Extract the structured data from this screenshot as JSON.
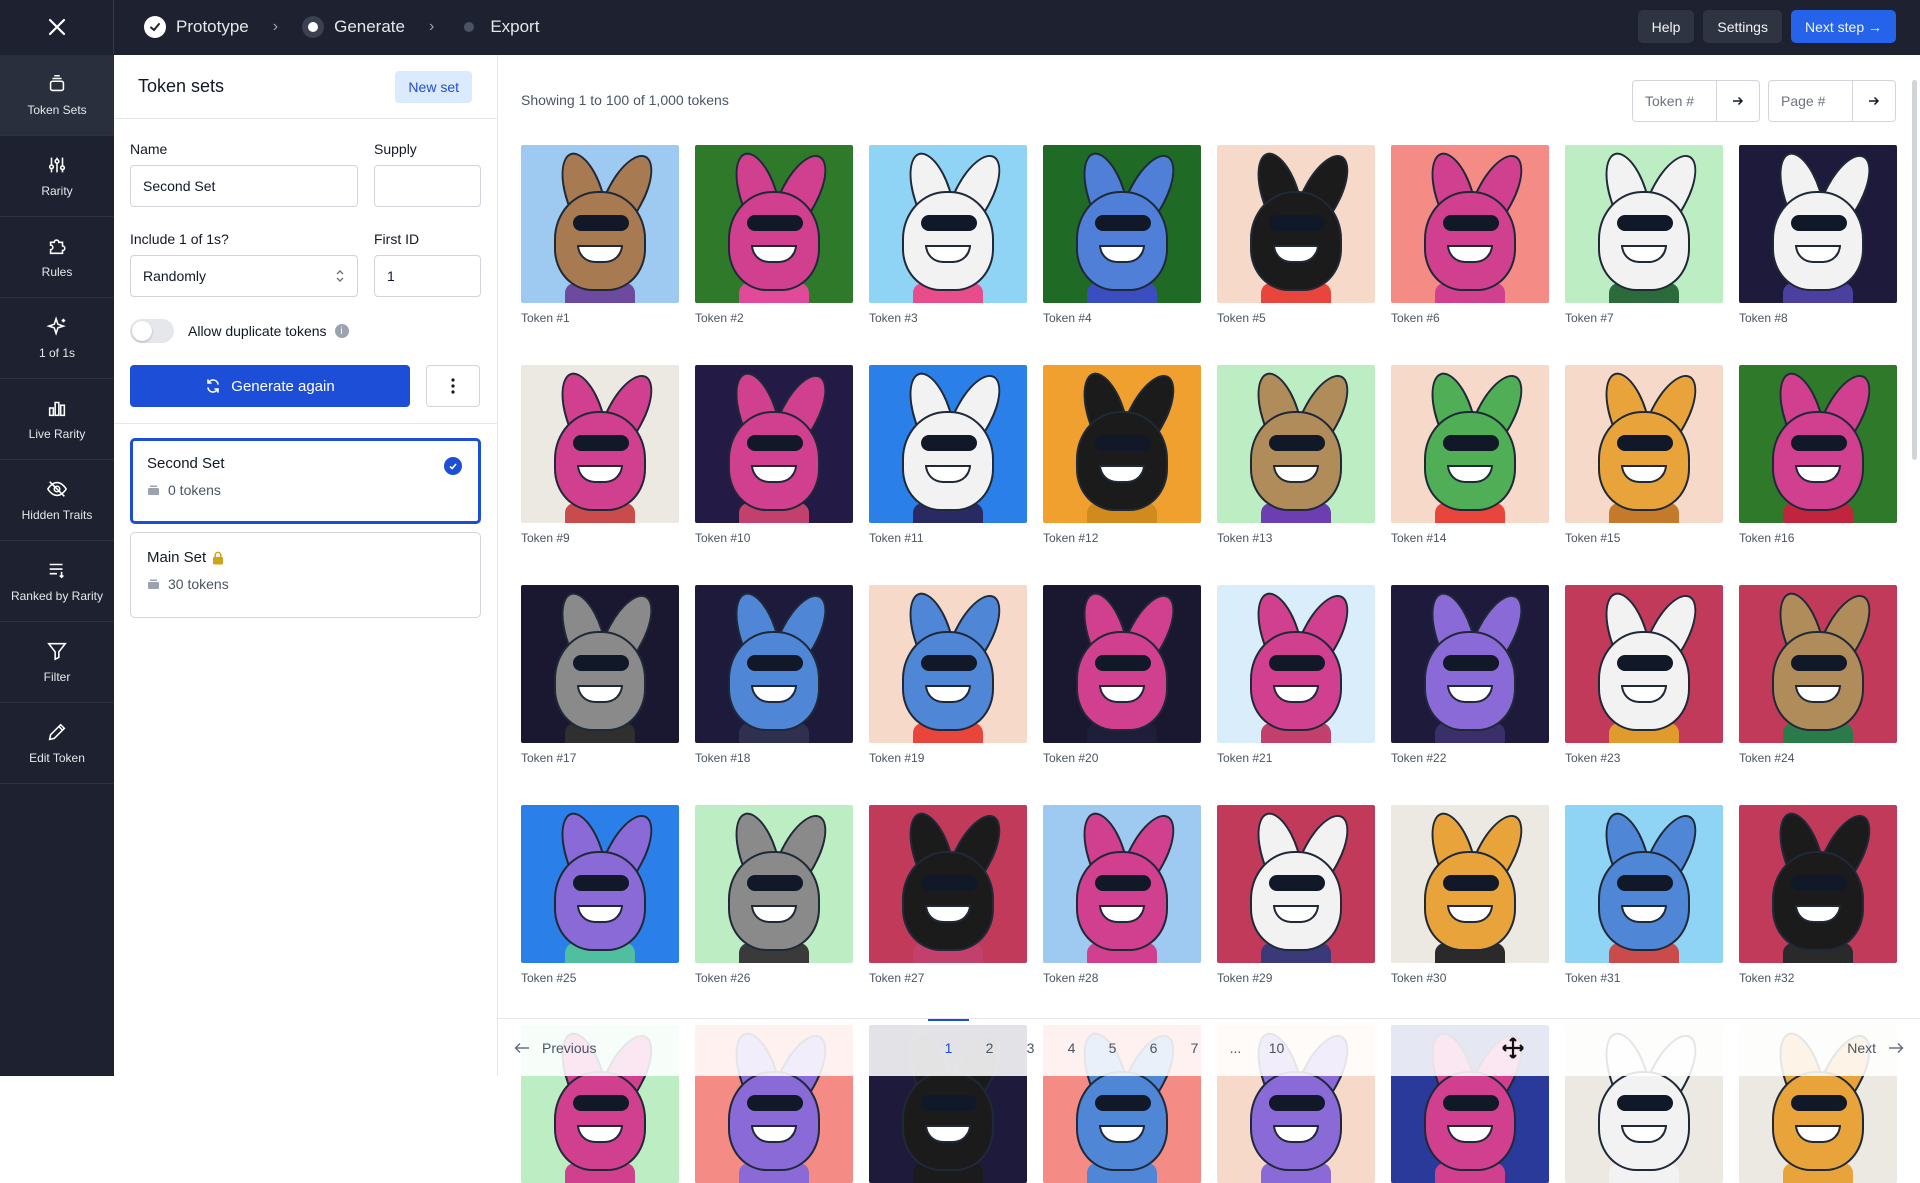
{
  "topbar": {
    "steps": [
      {
        "label": "Prototype",
        "state": "done"
      },
      {
        "label": "Generate",
        "state": "current"
      },
      {
        "label": "Export",
        "state": "upcoming"
      }
    ],
    "help_label": "Help",
    "settings_label": "Settings",
    "next_label": "Next step →",
    "accent": "#2563eb"
  },
  "rail": {
    "items": [
      {
        "label": "Token Sets",
        "icon": "stack-icon",
        "active": true
      },
      {
        "label": "Rarity",
        "icon": "sliders-icon"
      },
      {
        "label": "Rules",
        "icon": "puzzle-icon"
      },
      {
        "label": "1 of 1s",
        "icon": "sparkle-icon"
      },
      {
        "label": "Live Rarity",
        "icon": "bar-chart-icon"
      },
      {
        "label": "Hidden Traits",
        "icon": "eye-off-icon"
      },
      {
        "label": "Ranked by Rarity",
        "icon": "sort-list-icon"
      },
      {
        "label": "Filter",
        "icon": "filter-icon"
      },
      {
        "label": "Edit Token",
        "icon": "pencil-icon"
      }
    ]
  },
  "panel": {
    "title": "Token sets",
    "new_set_label": "New set",
    "name_label": "Name",
    "name_value": "Second Set",
    "supply_label": "Supply",
    "supply_value": "",
    "include_label": "Include 1 of 1s?",
    "include_value": "Randomly",
    "first_id_label": "First ID",
    "first_id_value": "1",
    "duplicate_label": "Allow duplicate tokens",
    "generate_label": "Generate again",
    "sets": [
      {
        "name": "Second Set",
        "count": "0 tokens",
        "selected": true,
        "locked": false
      },
      {
        "name": "Main Set",
        "count": "30 tokens",
        "selected": false,
        "locked": true
      }
    ]
  },
  "main": {
    "showing": "Showing 1 to 100 of 1,000 tokens",
    "token_jump_placeholder": "Token #",
    "page_jump_placeholder": "Page #",
    "tokens": [
      {
        "label": "Token #1",
        "bg": "#9ec9f0",
        "fur": "#a87a52",
        "body": "#6b4aa0"
      },
      {
        "label": "Token #2",
        "bg": "#2f7a2a",
        "fur": "#d13f8f",
        "body": "#e14a9b"
      },
      {
        "label": "Token #3",
        "bg": "#8fd3f5",
        "fur": "#f2f2f2",
        "body": "#e84c8b"
      },
      {
        "label": "Token #4",
        "bg": "#1f6a24",
        "fur": "#4f7fd6",
        "body": "#3b4ec1"
      },
      {
        "label": "Token #5",
        "bg": "#f6d9c8",
        "fur": "#1b1b1b",
        "body": "#e8453c"
      },
      {
        "label": "Token #6",
        "bg": "#f58b85",
        "fur": "#d13f8f",
        "body": "#d13f8f"
      },
      {
        "label": "Token #7",
        "bg": "#bdeec3",
        "fur": "#f2f2f2",
        "body": "#2b6a3a"
      },
      {
        "label": "Token #8",
        "bg": "#1d1a3c",
        "fur": "#f2f2f2",
        "body": "#4b3fa0"
      },
      {
        "label": "Token #9",
        "bg": "#ece8e2",
        "fur": "#d13f8f",
        "body": "#c94b4b"
      },
      {
        "label": "Token #10",
        "bg": "#231a45",
        "fur": "#d13f8f",
        "body": "#c2406c"
      },
      {
        "label": "Token #11",
        "bg": "#2b7fe8",
        "fur": "#f2f2f2",
        "body": "#2a2a62"
      },
      {
        "label": "Token #12",
        "bg": "#f0a02e",
        "fur": "#1b1b1b",
        "body": "#d08a1e"
      },
      {
        "label": "Token #13",
        "bg": "#bdeec3",
        "fur": "#b08c5a",
        "body": "#6b3fb0"
      },
      {
        "label": "Token #14",
        "bg": "#f6d9c8",
        "fur": "#4fae56",
        "body": "#e8453c"
      },
      {
        "label": "Token #15",
        "bg": "#f6d9c8",
        "fur": "#e8a43a",
        "body": "#c47a2a"
      },
      {
        "label": "Token #16",
        "bg": "#2f7a2a",
        "fur": "#d13f8f",
        "body": "#c0253d"
      },
      {
        "label": "Token #17",
        "bg": "#1a1730",
        "fur": "#8a8a8a",
        "body": "#2f2f2f"
      },
      {
        "label": "Token #18",
        "bg": "#1d1a3c",
        "fur": "#4f86d6",
        "body": "#2f2f4f"
      },
      {
        "label": "Token #19",
        "bg": "#f6d9c8",
        "fur": "#4f86d6",
        "body": "#e8453c"
      },
      {
        "label": "Token #20",
        "bg": "#1a1730",
        "fur": "#d13f8f",
        "body": "#1e1e3a"
      },
      {
        "label": "Token #21",
        "bg": "#d9eefa",
        "fur": "#d13f8f",
        "body": "#c2406c"
      },
      {
        "label": "Token #22",
        "bg": "#1d1a3c",
        "fur": "#8a6ad6",
        "body": "#3b2f6a"
      },
      {
        "label": "Token #23",
        "bg": "#c13a5a",
        "fur": "#f2f2f2",
        "body": "#e09a2e"
      },
      {
        "label": "Token #24",
        "bg": "#c13a5a",
        "fur": "#b08c5a",
        "body": "#2b7a4a"
      },
      {
        "label": "Token #25",
        "bg": "#2b7fe8",
        "fur": "#8a6ad6",
        "body": "#4fbfa0"
      },
      {
        "label": "Token #26",
        "bg": "#bdeec3",
        "fur": "#8a8a8a",
        "body": "#3a3a3a"
      },
      {
        "label": "Token #27",
        "bg": "#c13a5a",
        "fur": "#1b1b1b",
        "body": "#c2406c"
      },
      {
        "label": "Token #28",
        "bg": "#9ec9f0",
        "fur": "#d13f8f",
        "body": "#d13f8f"
      },
      {
        "label": "Token #29",
        "bg": "#c13a5a",
        "fur": "#f2f2f2",
        "body": "#3a3a7a"
      },
      {
        "label": "Token #30",
        "bg": "#ece8e2",
        "fur": "#e8a43a",
        "body": "#2a2a2a"
      },
      {
        "label": "Token #31",
        "bg": "#8fd3f5",
        "fur": "#4f86d6",
        "body": "#c94b4b"
      },
      {
        "label": "Token #32",
        "bg": "#c13a5a",
        "fur": "#1b1b1b",
        "body": "#2a2a2a"
      },
      {
        "label": "",
        "bg": "#bdeec3",
        "fur": "#d13f8f",
        "body": "#d13f8f"
      },
      {
        "label": "",
        "bg": "#f58b85",
        "fur": "#8a6ad6",
        "body": "#8a6ad6"
      },
      {
        "label": "",
        "bg": "#1d1a3c",
        "fur": "#1b1b1b",
        "body": "#1b1b1b"
      },
      {
        "label": "",
        "bg": "#f58b85",
        "fur": "#4f86d6",
        "body": "#4f86d6"
      },
      {
        "label": "",
        "bg": "#f6d9c8",
        "fur": "#8a6ad6",
        "body": "#8a6ad6"
      },
      {
        "label": "",
        "bg": "#2a3a9a",
        "fur": "#d13f8f",
        "body": "#d13f8f"
      },
      {
        "label": "",
        "bg": "#ece8e2",
        "fur": "#f2f2f2",
        "body": "#f2f2f2"
      },
      {
        "label": "",
        "bg": "#ece8e2",
        "fur": "#e8a43a",
        "body": "#e8a43a"
      }
    ],
    "pager": {
      "prev_label": "Previous",
      "next_label": "Next",
      "pages": [
        "1",
        "2",
        "3",
        "4",
        "5",
        "6",
        "7",
        "...",
        "10"
      ],
      "active_page": "1"
    }
  }
}
